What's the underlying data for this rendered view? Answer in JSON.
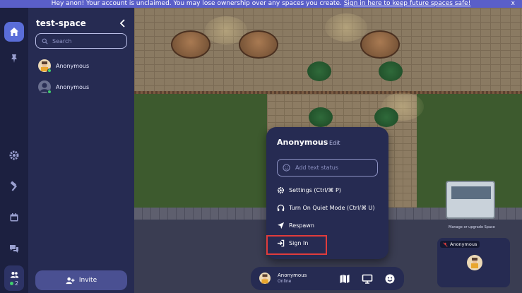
{
  "banner": {
    "message": "Hey anon! Your account is unclaimed. You may lose ownership over any spaces you create.",
    "link_text": "Sign in here to keep future spaces safe!",
    "close_label": "x"
  },
  "sidebar": {
    "space_name": "test-space",
    "search_placeholder": "Search",
    "users": [
      {
        "name": "Anonymous"
      },
      {
        "name": "Anonymous"
      }
    ],
    "invite_label": "Invite"
  },
  "rail": {
    "online_count": "2"
  },
  "popup": {
    "name": "Anonymous",
    "edit_label": "Edit",
    "status_placeholder": "Add text status",
    "menu": [
      {
        "label": "Settings (Ctrl/⌘ P)",
        "icon": "gear-icon"
      },
      {
        "label": "Turn On Quiet Mode (Ctrl/⌘ U)",
        "icon": "headphones-icon"
      },
      {
        "label": "Respawn",
        "icon": "navigation-arrow-icon"
      },
      {
        "label": "Sign In",
        "icon": "sign-in-icon"
      }
    ]
  },
  "bottom_bar": {
    "name": "Anonymous",
    "status": "Online"
  },
  "game": {
    "manage_text": "Manage or upgrade Space"
  },
  "video_tile": {
    "name": "Anonymous"
  },
  "colors": {
    "accent": "#5a6dd8",
    "online": "#3fcf6d",
    "highlight": "#e03c3c",
    "panel": "#262b52"
  }
}
